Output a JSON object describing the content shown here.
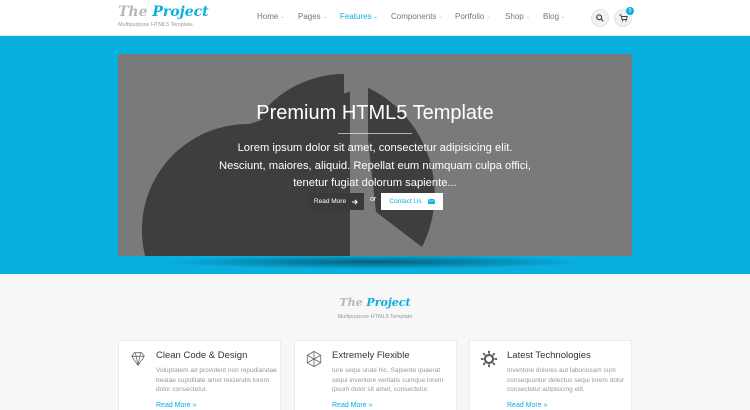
{
  "header": {
    "logo": {
      "the": "The",
      "project": "Project",
      "tagline": "Multipurpose HTML5 Template"
    },
    "nav": [
      {
        "label": "Home",
        "active": false
      },
      {
        "label": "Pages",
        "active": false
      },
      {
        "label": "Features",
        "active": true
      },
      {
        "label": "Components",
        "active": false
      },
      {
        "label": "Portfolio",
        "active": false
      },
      {
        "label": "Shop",
        "active": false
      },
      {
        "label": "Blog",
        "active": false
      }
    ],
    "search_icon": "search-icon",
    "cart_icon": "cart-icon",
    "cart_count": "0"
  },
  "hero": {
    "title": "Premium HTML5 Template",
    "text": "Lorem ipsum dolor sit amet, consectetur adipisicing elit. Nesciunt, maiores, aliquid. Repellat eum numquam culpa offici, tenetur fugiat dolorum sapiente...",
    "read_more": "Read More",
    "or": "or",
    "contact_us": "Contact Us",
    "background_color": "#09afdf",
    "slide_color": "#7a7a7a"
  },
  "section": {
    "logo": {
      "the": "The",
      "project": "Project",
      "tagline": "Multipurpose HTML5 Template"
    },
    "cards": [
      {
        "icon": "diamond-icon",
        "title": "Clean Code & Design",
        "text": "Voluptatem ad provident non repudiandae beatae cupiditate amet reiciendis lorem dolor consectetur.",
        "link": "Read More"
      },
      {
        "icon": "hexagon-icon",
        "title": "Extremely Flexible",
        "text": "Iure sequi unde hic. Sapiente quaerat sequi inventore veritatis cumque lorem ipsum dolor sit amet, consectetur.",
        "link": "Read More"
      },
      {
        "icon": "gear-icon",
        "title": "Latest Technologies",
        "text": "Inventore dolores aut laboriosam cum consequuntur delectus sequi lorem dolor consectetur adipisicing elit.",
        "link": "Read More"
      }
    ]
  },
  "colors": {
    "accent": "#09afdf",
    "dark_button": "#3a3a3a"
  }
}
